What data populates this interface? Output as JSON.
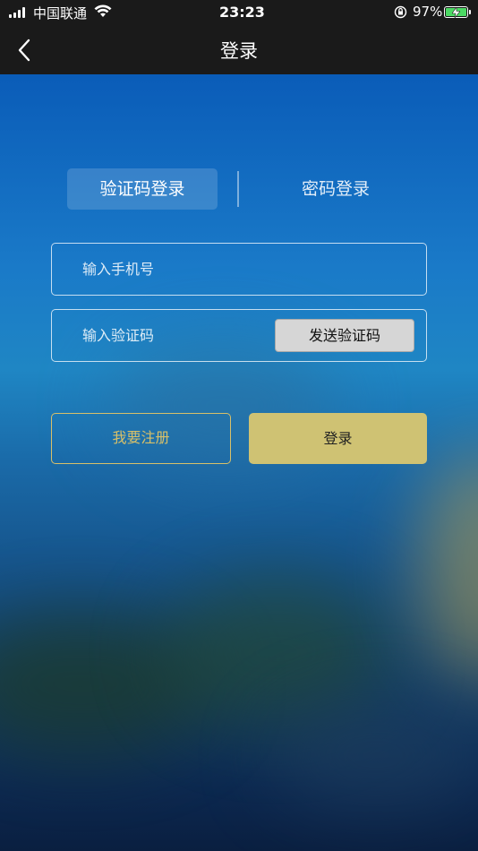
{
  "status_bar": {
    "carrier": "中国联通",
    "time": "23:23",
    "battery_percent": "97%",
    "battery_level": 0.97,
    "battery_color": "#4cd964"
  },
  "nav": {
    "title": "登录",
    "back_icon": "chevron-left-icon"
  },
  "tabs": {
    "active_label": "验证码登录",
    "inactive_label": "密码登录"
  },
  "form": {
    "phone_placeholder": "输入手机号",
    "phone_value": "",
    "code_placeholder": "输入验证码",
    "code_value": "",
    "send_code_label": "发送验证码"
  },
  "actions": {
    "register_label": "我要注册",
    "login_label": "登录",
    "accent_color": "#d8c069",
    "login_bg": "#cfc273"
  }
}
